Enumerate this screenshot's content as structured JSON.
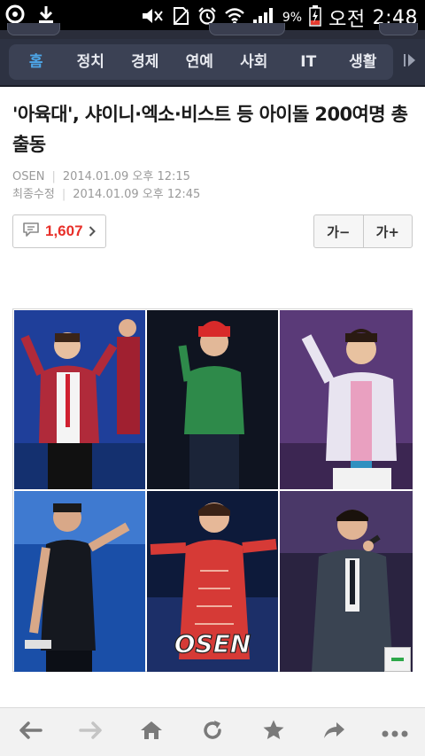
{
  "status_bar": {
    "battery_percent": "9%",
    "carrier": "오전",
    "time": "2:48",
    "icons": [
      "notification-app-icon",
      "download-icon",
      "mute-icon",
      "no-sim-icon",
      "alarm-icon",
      "wifi-icon",
      "signal-icon",
      "battery-charging-icon"
    ]
  },
  "nav": {
    "items": [
      {
        "label": "홈",
        "active": true
      },
      {
        "label": "정치",
        "active": false
      },
      {
        "label": "경제",
        "active": false
      },
      {
        "label": "연예",
        "active": false
      },
      {
        "label": "사회",
        "active": false
      },
      {
        "label": "IT",
        "active": false
      },
      {
        "label": "생활",
        "active": false
      }
    ],
    "more_icon": "play-arrow-icon"
  },
  "article": {
    "title": "'아육대', 샤이니·엑소·비스트 등 아이돌 200여명 총출동",
    "source": "OSEN",
    "published": "2014.01.09 오후 12:15",
    "modified_label": "최종수정",
    "modified": "2014.01.09 오후 12:45",
    "comment_count": "1,607",
    "font_decrease_label": "가−",
    "font_increase_label": "가+",
    "photo_watermark": "OSEN"
  },
  "toolbar": {
    "icons": [
      "back-icon",
      "forward-icon",
      "home-icon",
      "refresh-icon",
      "bookmark-star-icon",
      "share-icon",
      "more-icon"
    ]
  },
  "colors": {
    "nav_bg": "#2d3242",
    "nav_active": "#4da6e8",
    "comment_count": "#e8302a",
    "zoom_button": "#2ea84a"
  }
}
